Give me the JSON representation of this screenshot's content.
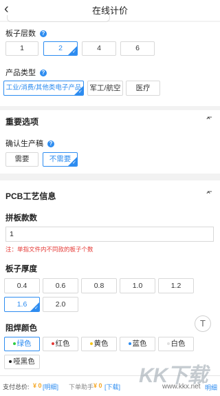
{
  "header": {
    "back_icon": "chevron-left-icon",
    "title": "在线计价"
  },
  "layers": {
    "label": "板子层数",
    "options": [
      "1",
      "2",
      "4",
      "6"
    ],
    "selected": "2"
  },
  "product_type": {
    "label": "产品类型",
    "options": [
      "工业/消费/其他类电子产品",
      "军工/航空",
      "医疗"
    ],
    "selected": "工业/消费/其他类电子产品"
  },
  "important": {
    "title": "重要选项",
    "collapse_icon": "double-chevron-up-icon",
    "confirm_label": "确认生产稿",
    "options": [
      "需要",
      "不需要"
    ],
    "selected": "不需要"
  },
  "pcb": {
    "title": "PCB工艺信息",
    "collapse_icon": "double-chevron-up-icon",
    "panel_label": "拼板款数",
    "panel_value": "1",
    "panel_note": "注：单指文件内不同款的板子个数",
    "thickness_label": "板子厚度",
    "thickness_options": [
      "0.4",
      "0.6",
      "0.8",
      "1.0",
      "1.2",
      "1.6",
      "2.0"
    ],
    "thickness_selected": "1.6",
    "solder_label": "阻焊颜色",
    "solder_options": [
      {
        "label": "绿色",
        "color": "#2ecc40"
      },
      {
        "label": "红色",
        "color": "#e53935"
      },
      {
        "label": "黄色",
        "color": "#f5c518"
      },
      {
        "label": "蓝色",
        "color": "#2d8cf0"
      },
      {
        "label": "白色",
        "color": "#e0e0e0"
      },
      {
        "label": "哑黑色",
        "color": "#222222"
      }
    ],
    "solder_selected": "绿色"
  },
  "fab": {
    "icon": "back-to-top-icon",
    "glyph": "T"
  },
  "bottom": {
    "pay_label": "支付总价:",
    "pay_amount": "¥ 0",
    "pay_link": "[明细]",
    "order_label": "下单助手",
    "order_amount": "¥ 0",
    "order_link": "[下载]"
  },
  "watermark": {
    "text": "KK下载",
    "url": "www.kkx.net",
    "extra": "明细"
  },
  "colors": {
    "accent": "#2d8cf0",
    "price": "#f5a623",
    "note": "#e53935"
  }
}
